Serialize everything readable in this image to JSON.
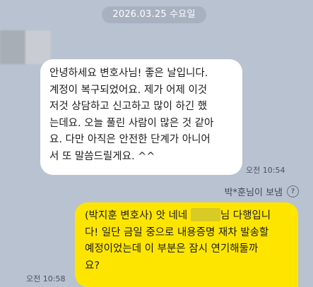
{
  "date_divider": "2026.03.25 수요일",
  "incoming": {
    "lines": [
      "안녕하세요 변호사님! 좋은 날입니다.",
      "계정이 복구되었어요. 제가 어제 이것",
      "저것 상담하고 신고하고 많이 하긴 했",
      "는데요. 오늘 풀린 사람이 많은 것 같아",
      "요. 다만 아직은 안전한 단계가 아니어",
      "서 또 말씀드릴게요. ^^"
    ],
    "time": "오전 10:54"
  },
  "sender_label": "박*훈님이 보냄",
  "outgoing": {
    "part1": "(박지훈 변호사) 앗 네네 ",
    "part2": "님 다행입니",
    "lines": [
      "다! 일단 금일 중으로 내용증명 재차 발송할",
      "예정이었는데 이 부분은 잠시 연기해둘까",
      "요?"
    ],
    "time": "오전 10:58"
  }
}
